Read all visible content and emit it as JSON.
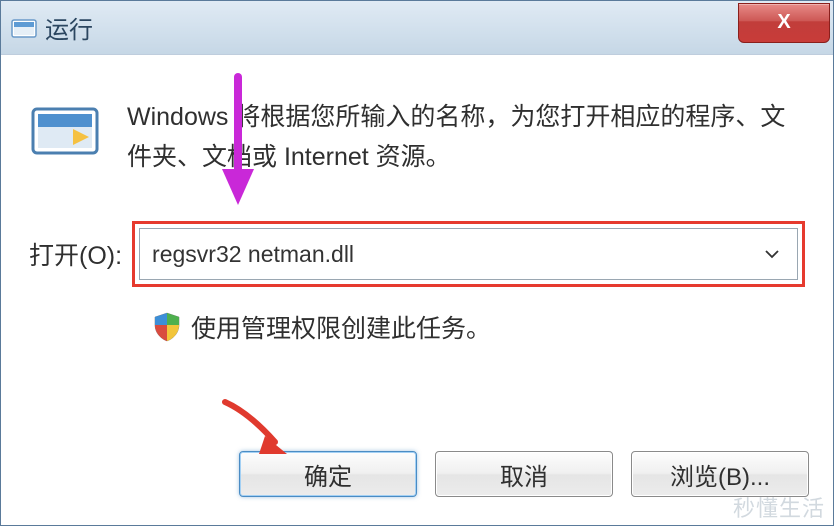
{
  "titlebar": {
    "title": "运行",
    "close_glyph": "X"
  },
  "content": {
    "description": "Windows 将根据您所输入的名称，为您打开相应的程序、文件夹、文档或 Internet 资源。",
    "open_label": "打开(O):",
    "input_value": "regsvr32 netman.dll",
    "admin_note": "使用管理权限创建此任务。"
  },
  "buttons": {
    "ok": "确定",
    "cancel": "取消",
    "browse": "浏览(B)..."
  },
  "watermark": "秒懂生活",
  "colors": {
    "highlight_box": "#e63a2e",
    "annotation_arrow1": "#c928d8",
    "annotation_arrow2": "#e03a2e"
  }
}
